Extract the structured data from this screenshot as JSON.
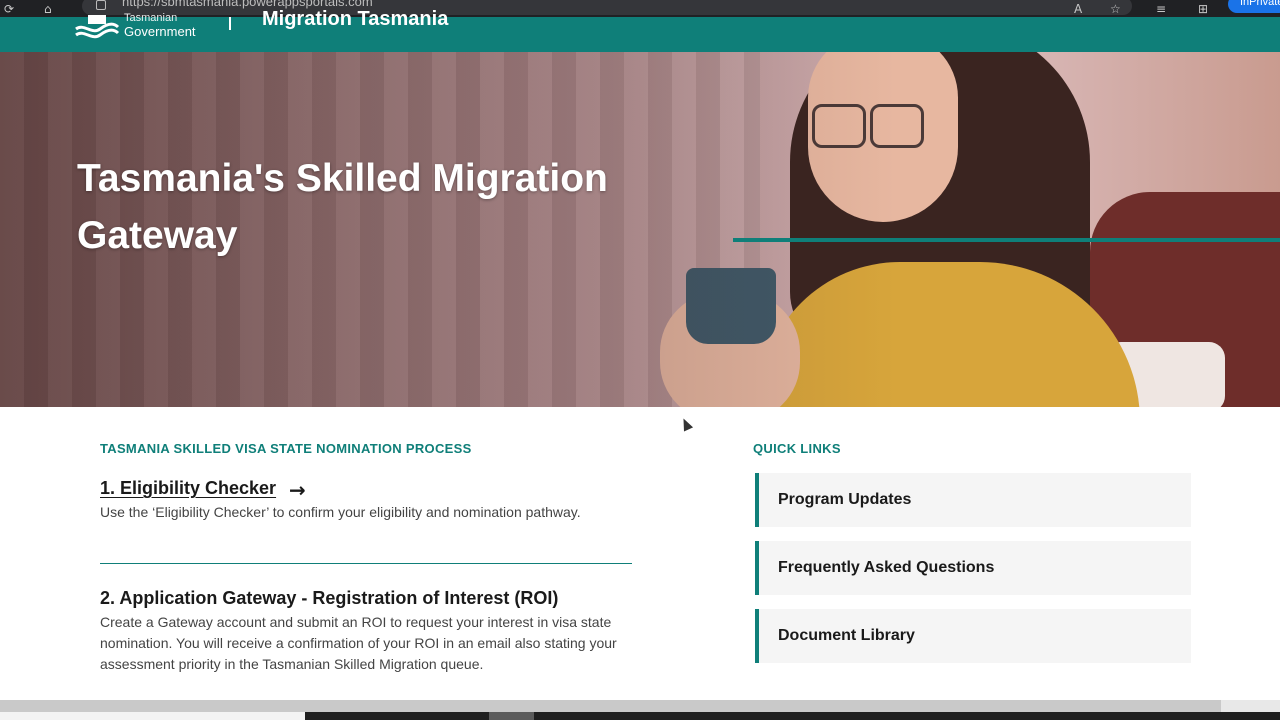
{
  "browser": {
    "url": "https://sbmtasmania.powerappsportals.com",
    "inprivate_label": "InPrivate",
    "icons": [
      "refresh-icon",
      "home-icon",
      "site-info-icon",
      "read-aloud-icon",
      "tracking-icon",
      "favorites-icon",
      "collections-icon"
    ]
  },
  "header": {
    "logo_line1": "Tasmanian",
    "logo_line2": "Government",
    "site_title": "Migration Tasmania"
  },
  "hero": {
    "title": "Tasmania's Skilled Migration Gateway"
  },
  "process": {
    "heading": "TASMANIA SKILLED VISA STATE NOMINATION PROCESS",
    "steps": [
      {
        "title": "1. Eligibility Checker",
        "arrow": "→",
        "description": "Use the ‘Eligibility Checker’ to confirm your eligibility and nomination pathway."
      },
      {
        "title": "2. Application Gateway - Registration of Interest (ROI)",
        "description": "Create a Gateway account and submit an ROI to request your interest in visa state nomination. You will receive a confirmation of your ROI in an email also stating your assessment priority in the Tasmanian Skilled Migration queue."
      }
    ]
  },
  "quick_links": {
    "heading": "QUICK LINKS",
    "items": [
      {
        "label": "Program Updates"
      },
      {
        "label": "Frequently Asked Questions"
      },
      {
        "label": "Document Library"
      }
    ]
  },
  "colors": {
    "brand_teal": "#0f7f79",
    "card_bg": "#f5f5f5"
  }
}
